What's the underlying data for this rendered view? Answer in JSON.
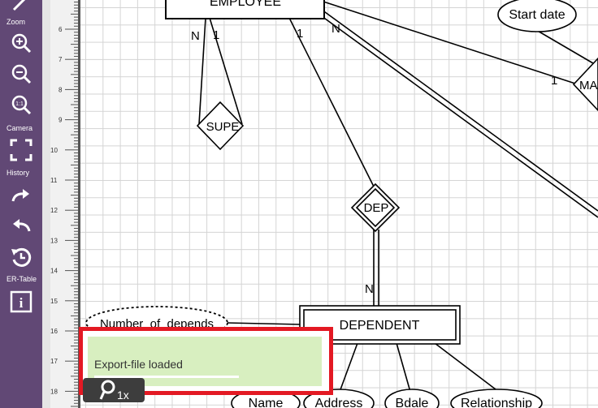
{
  "toolbar": {
    "sections": {
      "zoom": "Zoom",
      "camera": "Camera",
      "history": "History",
      "er_table": "ER-Table"
    },
    "buttons": {
      "zoom_in": "zoom-in-icon",
      "zoom_out": "zoom-out-icon",
      "zoom_reset": "zoom-reset-icon",
      "zoom_reset_label": "1:1",
      "fit_camera": "fullscreen-icon",
      "redo": "redo-icon",
      "undo": "undo-icon",
      "history_restore": "history-restore-icon",
      "info": "info-icon",
      "info_label": "i"
    },
    "accent": "#614875"
  },
  "ruler": {
    "numbers": [
      "6",
      "7",
      "8",
      "9",
      "10",
      "11",
      "12",
      "13",
      "14",
      "15",
      "16",
      "17",
      "18"
    ]
  },
  "diagram": {
    "entities": {
      "employee": "EMPLOYEE",
      "dependent": "DEPENDENT"
    },
    "relationships": {
      "supervision": "SUPE",
      "dependents_of": "DEP",
      "manages": "MA"
    },
    "attributes": {
      "start_date": "Start date",
      "number_of_dependents": "Number_of_depends",
      "name": "Name",
      "address": "Address",
      "bdate": "Bdale",
      "relationship": "Relationship"
    },
    "cardinalities": {
      "supe_n": "N",
      "supe_1": "1",
      "dep_1": "1",
      "employee_n": "N",
      "manages_1": "1",
      "dep_n": "N"
    }
  },
  "toast": {
    "message": "Export-file loaded",
    "progress": 0.6,
    "border_color": "#e31923",
    "background": "#d8efc0"
  },
  "zoom_chip": {
    "text": "1x",
    "icon": "search-icon"
  }
}
